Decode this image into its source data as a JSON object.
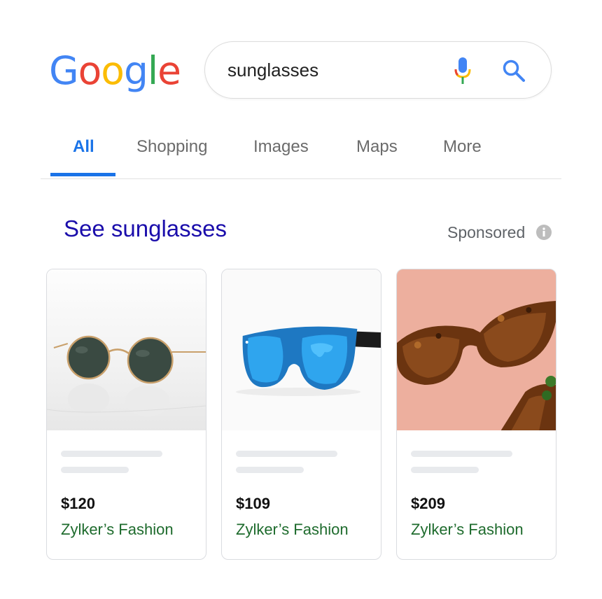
{
  "logo": {
    "letters": [
      "G",
      "o",
      "o",
      "g",
      "l",
      "e"
    ]
  },
  "search": {
    "query": "sunglasses"
  },
  "tabs": [
    {
      "label": "All"
    },
    {
      "label": "Shopping"
    },
    {
      "label": "Images"
    },
    {
      "label": "Maps"
    },
    {
      "label": "More"
    }
  ],
  "ads": {
    "heading": "See sunglasses",
    "sponsored": "Sponsored",
    "products": [
      {
        "price": "$120",
        "store": "Zylker’s Fashion",
        "image": "round-gold-sunglasses"
      },
      {
        "price": "$109",
        "store": "Zylker’s Fashion",
        "image": "blue-mirrored-sunglasses"
      },
      {
        "price": "$209",
        "store": "Zylker’s Fashion",
        "image": "tortoiseshell-cat-eye-sunglasses"
      }
    ]
  },
  "colors": {
    "accent_blue": "#1a73e8",
    "link_blue": "#1a0dab",
    "store_green": "#1e6b2d",
    "google_blue": "#4285f4",
    "google_red": "#ea4335",
    "google_yellow": "#fbbc05",
    "google_green": "#34a853"
  }
}
